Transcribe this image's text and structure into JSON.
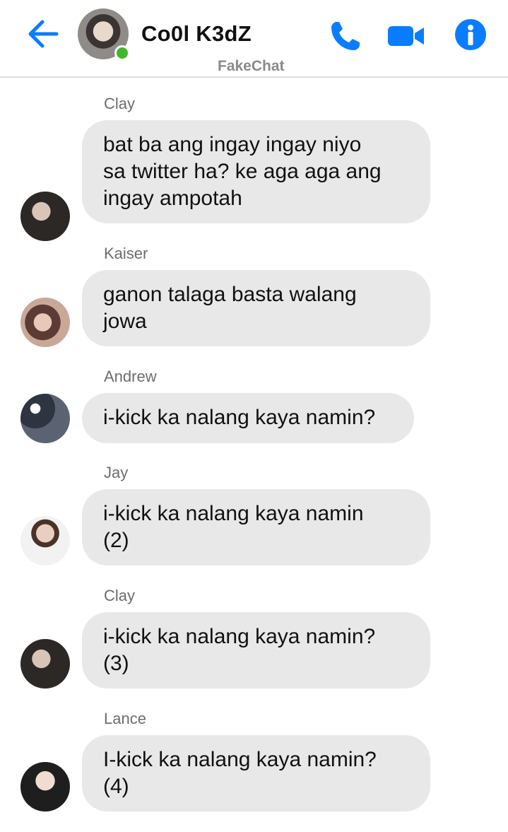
{
  "header": {
    "title": "Co0l K3dZ",
    "subtitle": "FakeChat",
    "online_color": "#42b72a",
    "accent_color": "#0a7cff",
    "icons": [
      "back-arrow-icon",
      "phone-icon",
      "video-camera-icon",
      "info-icon"
    ]
  },
  "messages": [
    {
      "sender": "Clay",
      "text": "bat ba ang ingay ingay niyo\nsa twitter ha? ke aga aga ang\ningay ampotah"
    },
    {
      "sender": "Kaiser",
      "text": "ganon talaga basta walang\njowa"
    },
    {
      "sender": "Andrew",
      "text": "i-kick ka nalang kaya namin?"
    },
    {
      "sender": "Jay",
      "text": "i-kick ka nalang kaya namin\n(2)"
    },
    {
      "sender": "Clay",
      "text": "i-kick ka nalang kaya namin?\n(3)"
    },
    {
      "sender": "Lance",
      "text": "I-kick ka nalang kaya namin?\n(4)"
    }
  ],
  "bubble_color": "#e8e8e8"
}
